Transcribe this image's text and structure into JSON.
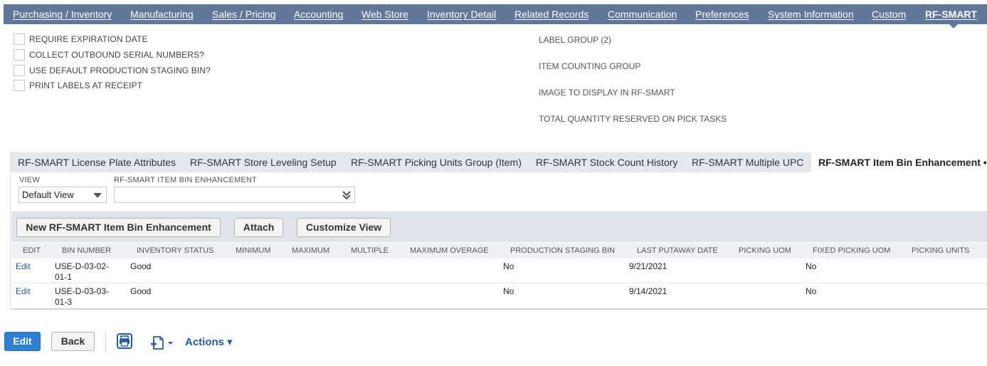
{
  "topnav": {
    "tabs": [
      {
        "label": "Purchasing / Inventory"
      },
      {
        "label": "Manufacturing"
      },
      {
        "label": "Sales / Pricing"
      },
      {
        "label": "Accounting"
      },
      {
        "label": "Web Store"
      },
      {
        "label": "Inventory Detail"
      },
      {
        "label": "Related Records"
      },
      {
        "label": "Communication"
      },
      {
        "label": "Preferences"
      },
      {
        "label": "System Information"
      },
      {
        "label": "Custom"
      },
      {
        "label": "RF-SMART"
      }
    ],
    "active": "RF-SMART"
  },
  "checkboxes": [
    {
      "label": "REQUIRE EXPIRATION DATE",
      "checked": false
    },
    {
      "label": "COLLECT OUTBOUND SERIAL NUMBERS?",
      "checked": false
    },
    {
      "label": "USE DEFAULT PRODUCTION STAGING BIN?",
      "checked": false
    },
    {
      "label": "PRINT LABELS AT RECEIPT",
      "checked": false
    }
  ],
  "fields": [
    {
      "label": "LABEL GROUP (2)"
    },
    {
      "label": "ITEM COUNTING GROUP"
    },
    {
      "label": "IMAGE TO DISPLAY IN RF-SMART"
    },
    {
      "label": "TOTAL QUANTITY RESERVED ON PICK TASKS"
    }
  ],
  "subtabs": [
    {
      "label": "RF-SMART License Plate Attributes"
    },
    {
      "label": "RF-SMART Store Leveling Setup"
    },
    {
      "label": "RF-SMART Picking Units Group (Item)"
    },
    {
      "label": "RF-SMART Stock Count History"
    },
    {
      "label": "RF-SMART Multiple UPC"
    },
    {
      "label": "RF-SMART Item Bin Enhancement •"
    }
  ],
  "filters": {
    "view_label": "VIEW",
    "view_value": "Default View",
    "enh_label": "RF-SMART ITEM BIN ENHANCEMENT",
    "enh_value": ""
  },
  "buttons": {
    "new": "New RF-SMART Item Bin Enhancement",
    "attach": "Attach",
    "customize": "Customize View"
  },
  "table": {
    "columns": [
      "EDIT",
      "BIN NUMBER",
      "INVENTORY STATUS",
      "MINIMUM",
      "MAXIMUM",
      "MULTIPLE",
      "MAXIMUM OVERAGE",
      "PRODUCTION STAGING BIN",
      "LAST PUTAWAY DATE",
      "PICKING UOM",
      "FIXED PICKING UOM",
      "PICKING UNITS"
    ],
    "rows": [
      {
        "edit": "Edit",
        "bin_1": "USE-D-03-02-",
        "bin_2": "01-1",
        "status": "Good",
        "staging": "No",
        "putaway": "9/21/2021",
        "fixed_uom": "No"
      },
      {
        "edit": "Edit",
        "bin_1": "USE-D-03-03-",
        "bin_2": "01-3",
        "status": "Good",
        "staging": "No",
        "putaway": "9/14/2021",
        "fixed_uom": "No"
      }
    ]
  },
  "actions": {
    "edit": "Edit",
    "back": "Back",
    "print_icon": "printer-icon",
    "new_doc_icon": "new-document-icon",
    "actions_label": "Actions ▾"
  },
  "colors": {
    "nav_bg": "#607799",
    "primary_button": "#2d7fd4",
    "link": "#255ba1"
  }
}
